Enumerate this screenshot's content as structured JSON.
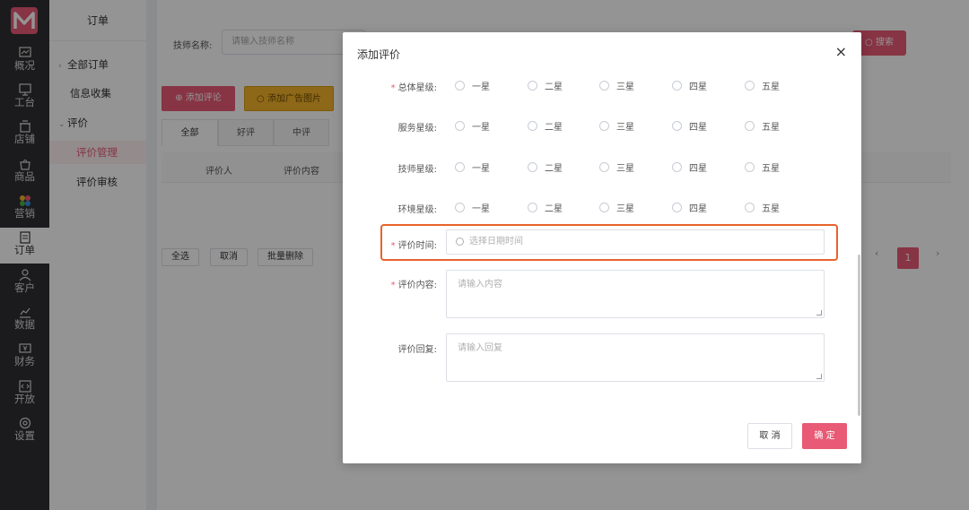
{
  "colors": {
    "accent": "#e85a75",
    "highlight": "#e8632d",
    "nav_bg": "#2f3033"
  },
  "nav": {
    "items": [
      {
        "label": "概况",
        "icon": "overview-icon"
      },
      {
        "label": "工台",
        "icon": "workbench-icon"
      },
      {
        "label": "店铺",
        "icon": "store-icon"
      },
      {
        "label": "商品",
        "icon": "product-icon"
      },
      {
        "label": "营销",
        "icon": "marketing-icon"
      },
      {
        "label": "订单",
        "icon": "order-icon"
      },
      {
        "label": "客户",
        "icon": "customer-icon"
      },
      {
        "label": "数据",
        "icon": "data-icon"
      },
      {
        "label": "财务",
        "icon": "finance-icon"
      },
      {
        "label": "开放",
        "icon": "open-icon"
      },
      {
        "label": "设置",
        "icon": "settings-icon"
      }
    ],
    "active": "订单"
  },
  "submenu": {
    "title": "订单",
    "items": [
      {
        "label": "全部订单"
      },
      {
        "label": "信息收集"
      },
      {
        "label": "评价"
      },
      {
        "label": "评价管理"
      },
      {
        "label": "评价审核"
      }
    ]
  },
  "main": {
    "search_label": "技师名称:",
    "search_placeholder": "请输入技师名称",
    "search_button": "搜索",
    "add_review_button": "添加评论",
    "add_ad_button": "添加广告图片",
    "tabs": [
      {
        "label": "全部"
      },
      {
        "label": "好评"
      },
      {
        "label": "中评"
      }
    ],
    "columns": [
      "评价人",
      "评价内容"
    ],
    "select_all": "全选",
    "cancel": "取消",
    "batch_delete": "批量删除",
    "pager": {
      "prev": "‹",
      "current": "1",
      "next": "›"
    }
  },
  "modal": {
    "title": "添加评价",
    "close": "×",
    "rating_rows": [
      {
        "label": "总体星级:",
        "required": true
      },
      {
        "label": "服务星级:",
        "required": false
      },
      {
        "label": "技师星级:",
        "required": false
      },
      {
        "label": "环境星级:",
        "required": false
      }
    ],
    "star_options": [
      "一星",
      "二星",
      "三星",
      "四星",
      "五星"
    ],
    "time_label": "评价时间:",
    "time_placeholder": "选择日期时间",
    "content_label": "评价内容:",
    "content_placeholder": "请输入内容",
    "reply_label": "评价回复:",
    "reply_placeholder": "请输入回复",
    "cancel_button": "取 消",
    "ok_button": "确 定",
    "required_mark": "*"
  }
}
